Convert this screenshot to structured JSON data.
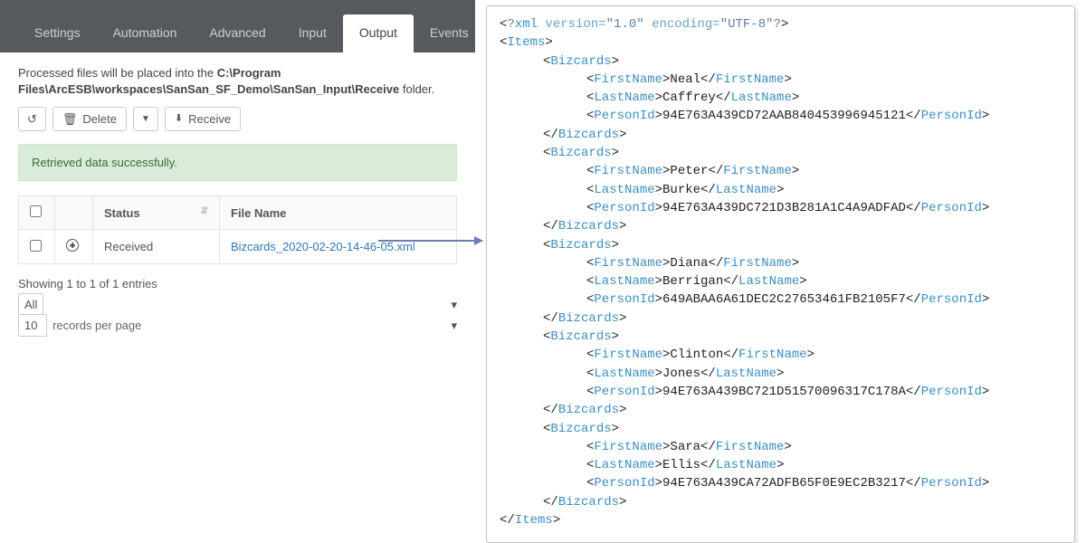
{
  "tabs": [
    "Settings",
    "Automation",
    "Advanced",
    "Input",
    "Output",
    "Events"
  ],
  "active_tab": "Output",
  "desc_prefix": "Processed files will be placed into the ",
  "desc_path": "C:\\Program Files\\ArcESB\\workspaces\\SanSan_SF_Demo\\SanSan_Input\\Receive",
  "desc_suffix": " folder.",
  "buttons": {
    "refresh_title": "Refresh",
    "delete": "Delete",
    "receive": "Receive"
  },
  "alert": "Retrieved data successfully.",
  "table": {
    "col_status": "Status",
    "col_file": "File Name",
    "rows": [
      {
        "status": "Received",
        "file": "Bizcards_2020-02-20-14-46-05.xml"
      }
    ]
  },
  "footer": {
    "showing": "Showing 1 to 1 of 1 entries",
    "filter_sel": "All",
    "page_size": "10",
    "rpp": "records per page"
  },
  "xml": {
    "decl_q": "?",
    "decl_name": "xml",
    "decl_attrs": " version=",
    "decl_v1": "\"1.0\"",
    "decl_attrs2": " encoding=",
    "decl_v2": "\"UTF-8\"",
    "root": "Items",
    "card": "Bizcards",
    "fn": "FirstName",
    "ln": "LastName",
    "pid": "PersonId",
    "records": [
      {
        "first": "Neal",
        "last": "Caffrey",
        "pid": "94E763A439CD72AAB840453996945121"
      },
      {
        "first": "Peter",
        "last": "Burke",
        "pid": "94E763A439DC721D3B281A1C4A9ADFAD"
      },
      {
        "first": "Diana",
        "last": "Berrigan",
        "pid": "649ABAA6A61DEC2C27653461FB2105F7"
      },
      {
        "first": "Clinton",
        "last": "Jones",
        "pid": "94E763A439BC721D51570096317C178A"
      },
      {
        "first": "Sara",
        "last": "Ellis",
        "pid": "94E763A439CA72ADFB65F0E9EC2B3217"
      }
    ]
  }
}
